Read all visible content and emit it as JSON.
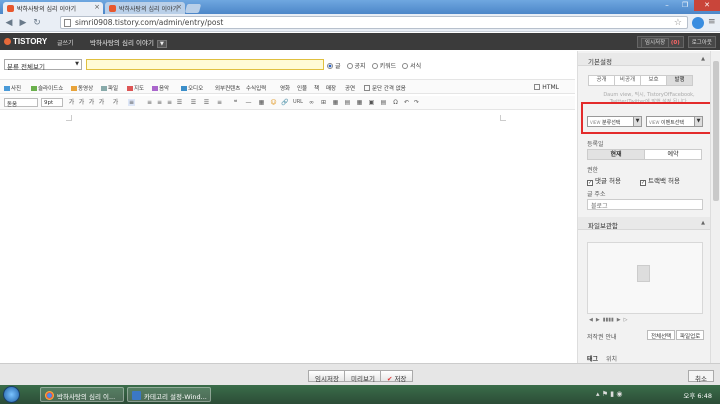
{
  "browser": {
    "tabs": [
      {
        "label": "박하사탕의 심리 이야기"
      },
      {
        "label": "박하사탕의 심리 이야기"
      }
    ],
    "url": "simri0908.tistory.com/admin/entry/post",
    "tab_close_glyph": "×",
    "window_controls": [
      "–",
      "❐",
      "✕"
    ]
  },
  "header": {
    "logo": "TISTORY",
    "logo_sub": "글쓰기",
    "blog_name": "박하사탕의 심리 이야기",
    "blog_caret": "▼",
    "temp_saved_label": "임시저장",
    "temp_saved_count": "(0)",
    "logout_label": "로그아웃"
  },
  "post": {
    "category_select": "분류 전체보기",
    "title_value": "",
    "type_options": [
      {
        "label": "글",
        "selected": true
      },
      {
        "label": "공지",
        "selected": false
      },
      {
        "label": "키워드",
        "selected": false
      },
      {
        "label": "서식",
        "selected": false
      }
    ]
  },
  "toolbar1": {
    "items": [
      "사진",
      "슬라이드쇼",
      "동영상",
      "파일",
      "지도",
      "음악",
      "오디오",
      "외부컨텐츠",
      "수식입력",
      "영화",
      "인물",
      "책",
      "매장",
      "공연"
    ],
    "paragraph_option": "문단 간격 없음",
    "html_label": "HTML"
  },
  "toolbar2": {
    "font": "돋움",
    "size": "9pt",
    "icons": [
      "가",
      "가",
      "가",
      "가",
      "가",
      "≡",
      "≡",
      "≡",
      "≡",
      "☰",
      "☰",
      "☰",
      "≡",
      "❝",
      "—",
      "▦",
      "☺",
      "🔗",
      "URL",
      "∞",
      "⊞",
      "▦",
      "▤",
      "▦",
      "▣",
      "▤",
      "Ω",
      "↶",
      "↷"
    ]
  },
  "sidebar": {
    "basic_settings": {
      "title": "기본설정",
      "visibility_tabs": [
        {
          "label": "공개",
          "selected": false
        },
        {
          "label": "비공개",
          "selected": false
        },
        {
          "label": "보호",
          "selected": false
        },
        {
          "label": "발행",
          "selected": true
        }
      ],
      "notice": "Daum view, 믹시, TistoryOfFacebook, Twitter(Twitter에 발행 설정 됩니다.",
      "view_category_prefix": "VIEW",
      "view_category": "분류선택",
      "view_subcategory_prefix": "VIEW",
      "view_subcategory": "이벤트선택",
      "register_date_label": "등록일",
      "date_options": [
        {
          "label": "현재",
          "selected": true
        },
        {
          "label": "예약",
          "selected": false
        }
      ],
      "permissions_label": "권한",
      "allow_comments": "댓글 허용",
      "allow_trackbacks": "트랙백 허용",
      "slug_label": "글 주소",
      "slug_value": "블로그"
    },
    "file_storage": {
      "title": "파일보관함",
      "controls": [
        "◀",
        "▶",
        "▮▮▮▮",
        "▶",
        "▷"
      ],
      "author_label": "저작권 안내",
      "select_all": "전체선택",
      "delete_file": "파일업로",
      "collapse_glyph": "▲"
    },
    "tags_label": "태그",
    "location_label": "위치"
  },
  "actions": {
    "temp_save": "임시저장",
    "preview": "미리보기",
    "save": "저장",
    "cancel": "취소"
  },
  "taskbar": {
    "tasks": [
      "박하사탕의 심리 이...",
      "카테고리 설정-Wind..."
    ],
    "clock": "오후 6:48"
  },
  "colors": {
    "accent_red": "#e32b2b",
    "title_bg": "#fffbd6",
    "header_bg": "#3b3b3b"
  }
}
